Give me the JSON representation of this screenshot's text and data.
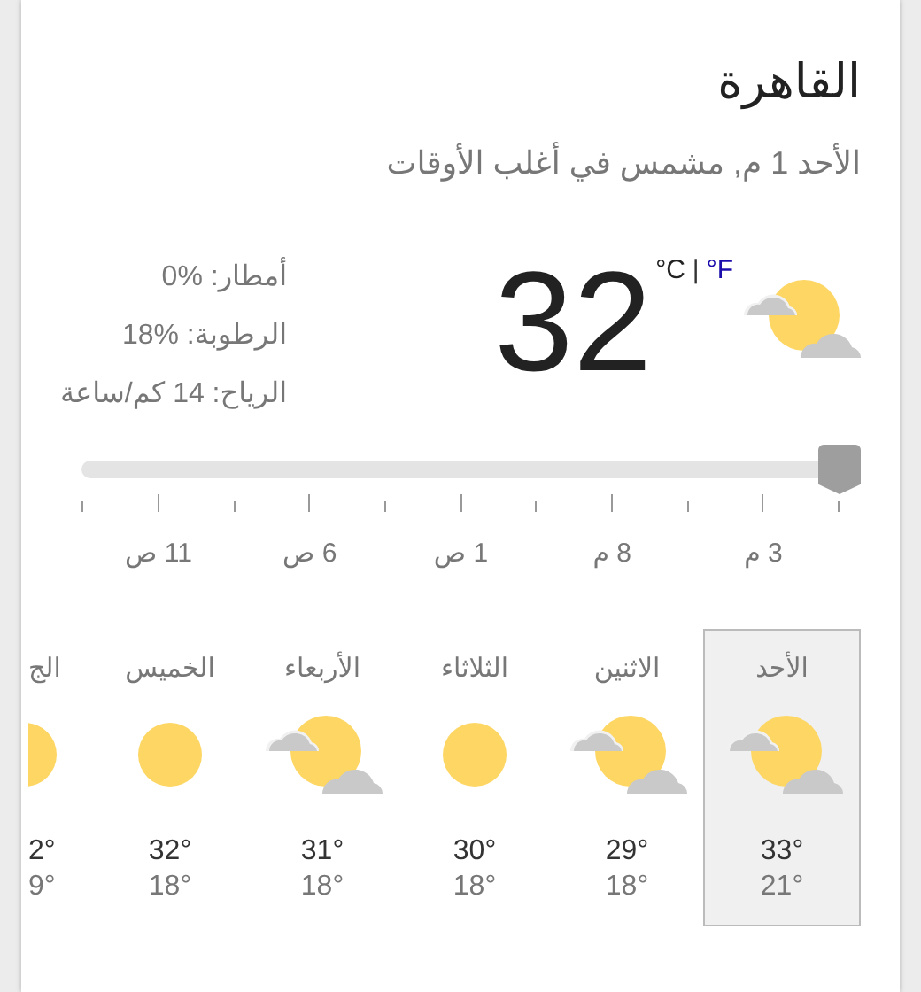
{
  "location": {
    "title": "القاهرة",
    "subtitle": "الأحد 1 م, مشمس في أغلب الأوقات"
  },
  "current": {
    "kind": "partly_cloudy",
    "temperature": "32",
    "units": [
      {
        "label": "°F",
        "selected": false
      },
      {
        "label": "°C",
        "selected": true
      }
    ],
    "unit_separator": "|",
    "details": [
      "أمطار: ‎0%",
      "الرطوبة: ‎18%",
      "الرياح: 14 كم/ساعة"
    ]
  },
  "timeline": {
    "level": 0,
    "labels": [
      "3 م",
      "8 م",
      "1 ص",
      "6 ص",
      "11 ص"
    ]
  },
  "forecast": [
    {
      "day": "الأحد",
      "kind": "partly_cloudy",
      "high": "33°",
      "low": "21°",
      "selected": true
    },
    {
      "day": "الاثنين",
      "kind": "partly_cloudy",
      "high": "29°",
      "low": "18°",
      "selected": false
    },
    {
      "day": "الثلاثاء",
      "kind": "sunny",
      "high": "30°",
      "low": "18°",
      "selected": false
    },
    {
      "day": "الأربعاء",
      "kind": "partly_cloudy",
      "high": "31°",
      "low": "18°",
      "selected": false
    },
    {
      "day": "الخميس",
      "kind": "sunny",
      "high": "32°",
      "low": "18°",
      "selected": false
    },
    {
      "day": "الج",
      "kind": "sunny",
      "high": "2°",
      "low": "9°",
      "selected": false,
      "cut": true
    }
  ]
}
